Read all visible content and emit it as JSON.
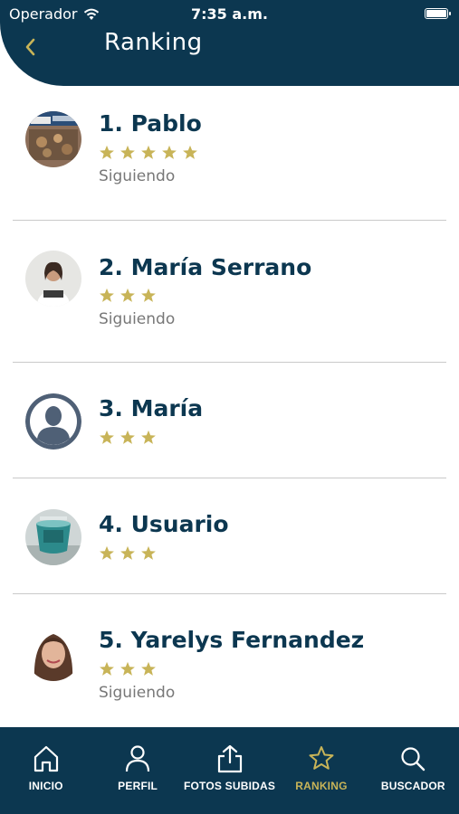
{
  "status_bar": {
    "carrier": "Operador",
    "time": "7:35 a.m."
  },
  "header": {
    "title": "Ranking"
  },
  "colors": {
    "primary": "#0c3750",
    "accent": "#c8b458",
    "muted": "#777777"
  },
  "ranking": [
    {
      "label": "1. Pablo",
      "stars": 5,
      "status": "Siguiendo",
      "avatar": "photo-food"
    },
    {
      "label": "2. María Serrano",
      "stars": 3,
      "status": "Siguiendo",
      "avatar": "photo-person"
    },
    {
      "label": "3. María",
      "stars": 3,
      "status": "",
      "avatar": "default-user-icon"
    },
    {
      "label": "4. Usuario",
      "stars": 3,
      "status": "",
      "avatar": "photo-cup"
    },
    {
      "label": "5. Yarelys Fernandez",
      "stars": 3,
      "status": "Siguiendo",
      "avatar": "photo-person"
    }
  ],
  "bottom_nav": [
    {
      "label": "INICIO",
      "icon": "home-icon",
      "active": false
    },
    {
      "label": "PERFIL",
      "icon": "user-icon",
      "active": false
    },
    {
      "label": "FOTOS SUBIDAS",
      "icon": "upload-icon",
      "active": false
    },
    {
      "label": "RANKING",
      "icon": "star-icon",
      "active": true
    },
    {
      "label": "BUSCADOR",
      "icon": "search-icon",
      "active": false
    }
  ]
}
